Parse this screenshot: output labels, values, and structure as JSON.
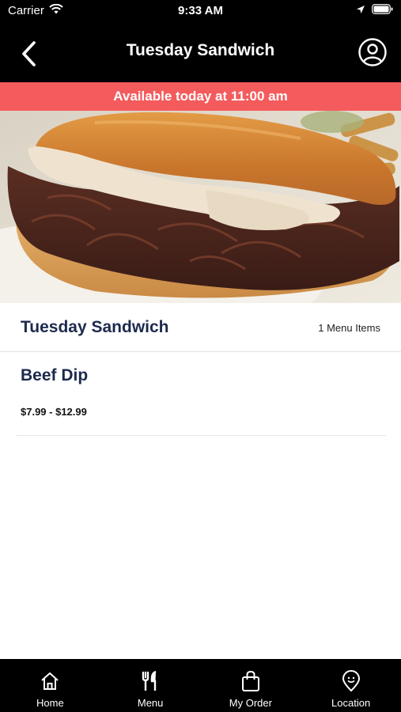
{
  "status_bar": {
    "carrier": "Carrier",
    "time": "9:33 AM"
  },
  "header": {
    "title": "Tuesday Sandwich",
    "back_icon": "chevron-left-icon",
    "profile_icon": "user-circle-icon"
  },
  "banner": {
    "text": "Available today at 11:00 am",
    "color": "#f45b5d"
  },
  "section": {
    "title": "Tuesday Sandwich",
    "count": "1 Menu Items"
  },
  "items": [
    {
      "name": "Beef Dip",
      "price": "$7.99 - $12.99"
    }
  ],
  "tabs": [
    {
      "label": "Home",
      "icon": "home-icon"
    },
    {
      "label": "Menu",
      "icon": "fork-knife-icon"
    },
    {
      "label": "My Order",
      "icon": "shopping-bag-icon"
    },
    {
      "label": "Location",
      "icon": "location-pin-icon"
    }
  ],
  "colors": {
    "accent": "#f45b5d",
    "title_text": "#1d2a4d",
    "bars": "#000000"
  }
}
